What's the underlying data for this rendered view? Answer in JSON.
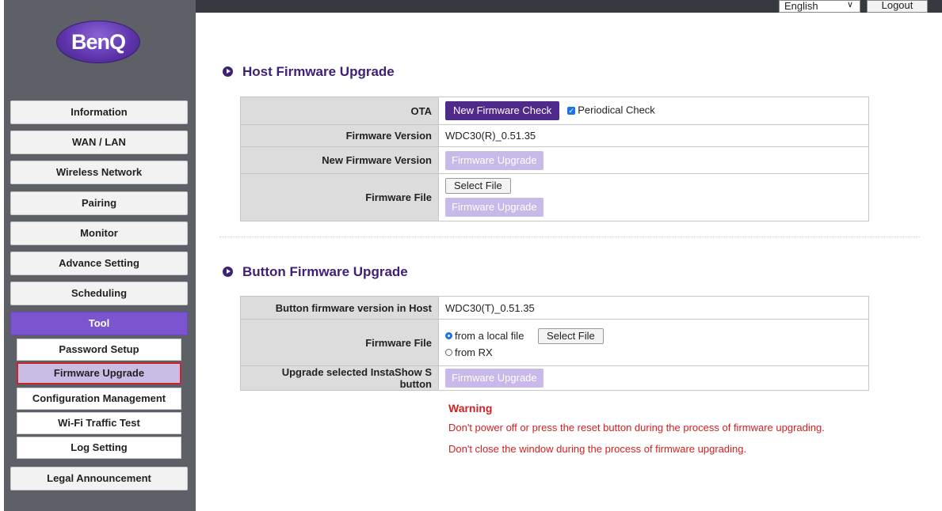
{
  "header": {
    "language": "English",
    "logout": "Logout"
  },
  "sidebar": {
    "logo_text": "BenQ",
    "menu": [
      "Information",
      "WAN / LAN",
      "Wireless Network",
      "Pairing",
      "Monitor",
      "Advance Setting",
      "Scheduling",
      "Tool"
    ],
    "submenu": [
      "Password Setup",
      "Firmware Upgrade",
      "Configuration Management",
      "Wi-Fi Traffic Test",
      "Log Setting"
    ],
    "legal": "Legal Announcement",
    "active_menu": "Tool",
    "active_sub": "Firmware Upgrade"
  },
  "host": {
    "title": "Host Firmware Upgrade",
    "ota_label": "OTA",
    "new_fw_check": "New Firmware Check",
    "periodical_check": "Periodical Check",
    "periodical_checked": true,
    "fw_version_label": "Firmware Version",
    "fw_version": "WDC30(R)_0.51.35",
    "new_fw_version_label": "New Firmware Version",
    "upgrade_btn": "Firmware Upgrade",
    "fw_file_label": "Firmware File",
    "select_file": "Select File",
    "upgrade_btn2": "Firmware Upgrade"
  },
  "button": {
    "title": "Button Firmware Upgrade",
    "version_label": "Button firmware version in Host",
    "version": "WDC30(T)_0.51.35",
    "fw_file_label": "Firmware File",
    "opt_local": "from a local file",
    "select_file": "Select File",
    "opt_rx": "from RX",
    "upgrade_label": "Upgrade selected InstaShow S button",
    "upgrade_btn": "Firmware Upgrade"
  },
  "warning": {
    "title": "Warning",
    "line1": "Don't power off or press the reset button during the process of firmware upgrading.",
    "line2": "Don't close the window during the process of firmware upgrading."
  },
  "colors": {
    "accent": "#7a55cf",
    "brand": "#4f2a8a",
    "warning": "#d32020"
  }
}
